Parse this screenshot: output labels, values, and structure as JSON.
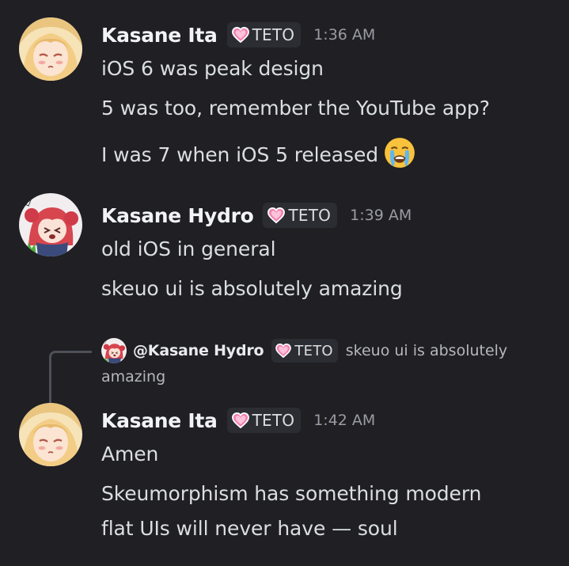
{
  "messages": [
    {
      "author": "Kasane Ita",
      "tag": "TETO",
      "time": "1:36 AM",
      "avatar": "kasane-ita-avatar",
      "lines": [
        "iOS 6 was peak design",
        "5 was too, remember the YouTube app?",
        "I was 7 when iOS 5 released"
      ],
      "emoji": "loudly-crying-face-emoji"
    },
    {
      "author": "Kasane Hydro",
      "tag": "TETO",
      "time": "1:39 AM",
      "avatar": "kasane-hydro-avatar",
      "lines": [
        "old iOS in general",
        "skeuo ui is absolutely amazing"
      ]
    },
    {
      "reply": {
        "mention": "@Kasane Hydro",
        "tag": "TETO",
        "snippet_part1": "skeuo ui is absolutely",
        "snippet_part2": "amazing"
      },
      "author": "Kasane Ita",
      "tag": "TETO",
      "time": "1:42 AM",
      "avatar": "kasane-ita-avatar",
      "lines": [
        "Amen",
        "Skeumorphism has something modern",
        "flat UIs will never have — soul"
      ]
    }
  ],
  "colors": {
    "background": "#1f1f24",
    "tag_background": "#2c2d32",
    "heart_pink": "#f47fb0",
    "username": "#f2f3f5",
    "text": "#dbdee1",
    "timestamp": "#9b9ca3"
  }
}
